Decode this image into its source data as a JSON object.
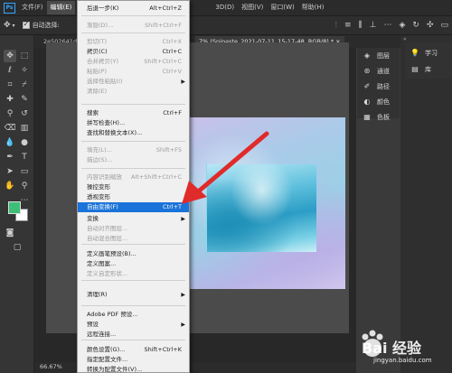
{
  "menubar": {
    "logo": "Ps",
    "items": [
      "文件(F)",
      "编辑(E)"
    ],
    "right_items": [
      "3D(D)",
      "视图(V)",
      "窗口(W)",
      "帮助(H)"
    ]
  },
  "optionsbar": {
    "auto_select_label": "自动选择:",
    "checkbox_checked": true
  },
  "tabs": {
    "doc1": "2e502641d…",
    "doc2": "7% (Snipaste_2021-07-11_15-17-48, RGB/8) * ×"
  },
  "edit_menu": {
    "items": [
      {
        "label": "后退一步(K)",
        "shortcut": "Alt+Ctrl+Z",
        "disabled": false
      },
      {
        "label": "渐隐(D)...",
        "shortcut": "Shift+Ctrl+F",
        "disabled": true
      },
      {
        "label": "剪切(T)",
        "shortcut": "Ctrl+X",
        "disabled": true
      },
      {
        "label": "拷贝(C)",
        "shortcut": "Ctrl+C",
        "disabled": false
      },
      {
        "label": "合并拷贝(Y)",
        "shortcut": "Shift+Ctrl+C",
        "disabled": true
      },
      {
        "label": "粘贴(P)",
        "shortcut": "Ctrl+V",
        "disabled": true
      },
      {
        "label": "选择性粘贴(I)",
        "shortcut": "",
        "disabled": true,
        "submenu": true
      },
      {
        "label": "清除(E)",
        "shortcut": "",
        "disabled": true
      },
      {
        "label": "搜索",
        "shortcut": "Ctrl+F",
        "disabled": false
      },
      {
        "label": "拼写检查(H)...",
        "shortcut": "",
        "disabled": false
      },
      {
        "label": "查找和替换文本(X)...",
        "shortcut": "",
        "disabled": false
      },
      {
        "label": "填充(L)...",
        "shortcut": "Shift+F5",
        "disabled": true
      },
      {
        "label": "描边(S)...",
        "shortcut": "",
        "disabled": true
      },
      {
        "label": "内容识别缩放",
        "shortcut": "Alt+Shift+Ctrl+C",
        "disabled": true
      },
      {
        "label": "操控变形",
        "shortcut": "",
        "disabled": false
      },
      {
        "label": "透视变形",
        "shortcut": "",
        "disabled": false
      },
      {
        "label": "自由变换(F)",
        "shortcut": "Ctrl+T",
        "disabled": false,
        "highlighted": true
      },
      {
        "label": "变换",
        "shortcut": "",
        "disabled": false,
        "submenu": true
      },
      {
        "label": "自动对齐图层...",
        "shortcut": "",
        "disabled": true
      },
      {
        "label": "自动混合图层...",
        "shortcut": "",
        "disabled": true
      },
      {
        "label": "定义画笔预设(B)...",
        "shortcut": "",
        "disabled": false
      },
      {
        "label": "定义图案...",
        "shortcut": "",
        "disabled": false
      },
      {
        "label": "定义自定形状...",
        "shortcut": "",
        "disabled": true
      },
      {
        "label": "清理(R)",
        "shortcut": "",
        "disabled": false,
        "submenu": true
      },
      {
        "label": "Adobe PDF 预设...",
        "shortcut": "",
        "disabled": false
      },
      {
        "label": "预设",
        "shortcut": "",
        "disabled": false,
        "submenu": true
      },
      {
        "label": "远程连接...",
        "shortcut": "",
        "disabled": false
      },
      {
        "label": "颜色设置(G)...",
        "shortcut": "Shift+Ctrl+K",
        "disabled": false
      },
      {
        "label": "指定配置文件...",
        "shortcut": "",
        "disabled": false
      },
      {
        "label": "转换为配置文件(V)...",
        "shortcut": "",
        "disabled": false
      }
    ]
  },
  "panels": {
    "dock": [
      {
        "icon": "layers-icon",
        "label": "图层"
      },
      {
        "icon": "channels-icon",
        "label": "通道"
      },
      {
        "icon": "paths-icon",
        "label": "路径"
      },
      {
        "icon": "color-icon",
        "label": "颜色"
      },
      {
        "icon": "swatches-icon",
        "label": "色板"
      }
    ],
    "dock2": [
      {
        "icon": "learn-icon",
        "label": "学习"
      },
      {
        "icon": "libraries-icon",
        "label": "库"
      }
    ]
  },
  "status": {
    "zoom": "66.67%"
  },
  "watermark": {
    "text": "Bai 经验",
    "url": "jingyan.baidu.com"
  },
  "colors": {
    "foreground": "#3dbf77",
    "background": "#ffffff",
    "highlight": "#1a73d9",
    "arrow": "#e02b2b"
  }
}
